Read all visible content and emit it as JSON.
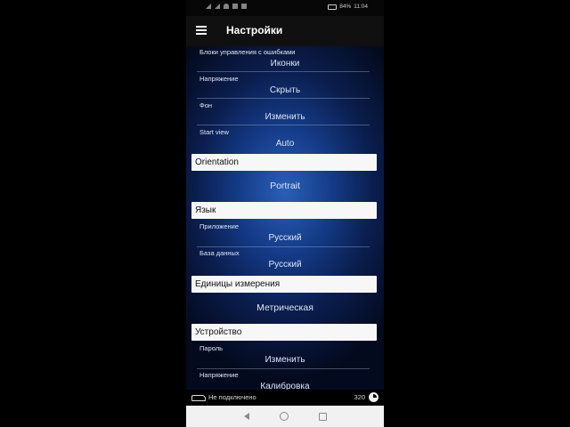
{
  "status_bar": {
    "battery": "84%",
    "time": "11:04"
  },
  "app_bar": {
    "title": "Настройки"
  },
  "settings": {
    "error_blocks": {
      "label": "Блоки управления с ошибками",
      "value": "Иконки"
    },
    "voltage": {
      "label": "Напряжение",
      "value": "Скрыть"
    },
    "background": {
      "label": "Фон",
      "value": "Изменить"
    },
    "start_view": {
      "label": "Start view",
      "value": "Auto"
    },
    "orientation": {
      "header": "Orientation",
      "value": "Portrait"
    },
    "language": {
      "header": "Язык",
      "app": {
        "label": "Приложение",
        "value": "Русский"
      },
      "database": {
        "label": "База данных",
        "value": "Русский"
      }
    },
    "units": {
      "header": "Единицы измерения",
      "value": "Метрическая"
    },
    "device": {
      "header": "Устройство",
      "password": {
        "label": "Пароль",
        "value": "Изменить"
      },
      "voltage": {
        "label": "Напряжение",
        "value": "Калибровка"
      }
    }
  },
  "bottom_bar": {
    "status": "Не подключено",
    "count": "320"
  },
  "icons": {
    "menu": "hamburger-menu-icon",
    "car": "car-icon",
    "gauge": "gauge-icon",
    "back": "back-triangle-icon",
    "home": "home-circle-icon",
    "recent": "recent-apps-square-icon"
  },
  "colors": {
    "section_header_bg": "#f7f7f7",
    "content_glow": "#2a5fb8",
    "app_bar_bg": "#101010"
  }
}
